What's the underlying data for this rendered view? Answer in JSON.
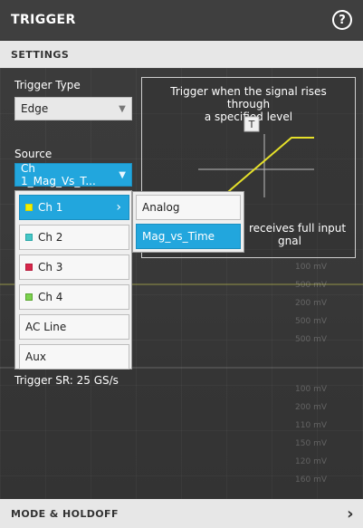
{
  "header": {
    "title": "TRIGGER",
    "help_icon": "?"
  },
  "settings_section": {
    "label": "SETTINGS"
  },
  "trigger_type": {
    "label": "Trigger Type",
    "value": "Edge"
  },
  "source": {
    "label": "Source",
    "value": "Ch 1_Mag_Vs_T..."
  },
  "info": {
    "description_1": "Trigger when the signal rises through",
    "description_2": "a specified level",
    "marker": "T",
    "tail_1": "receives full input",
    "tail_2": "gnal"
  },
  "source_menu": {
    "items": [
      {
        "label": "Ch 1",
        "color": "#f2f000"
      },
      {
        "label": "Ch 2",
        "color": "#46c7c7"
      },
      {
        "label": "Ch 3",
        "color": "#d7264a"
      },
      {
        "label": "Ch 4",
        "color": "#7bd24e"
      },
      {
        "label": "AC Line"
      },
      {
        "label": "Aux"
      }
    ]
  },
  "ch1_submenu": {
    "items": [
      {
        "label": "Analog"
      },
      {
        "label": "Mag_vs_Time"
      }
    ]
  },
  "trigger_sr": "Trigger SR: 25 GS/s",
  "mode_holdoff": {
    "label": "MODE & HOLDOFF",
    "chevron": "›"
  },
  "colors": {
    "accent": "#22a6dd"
  }
}
